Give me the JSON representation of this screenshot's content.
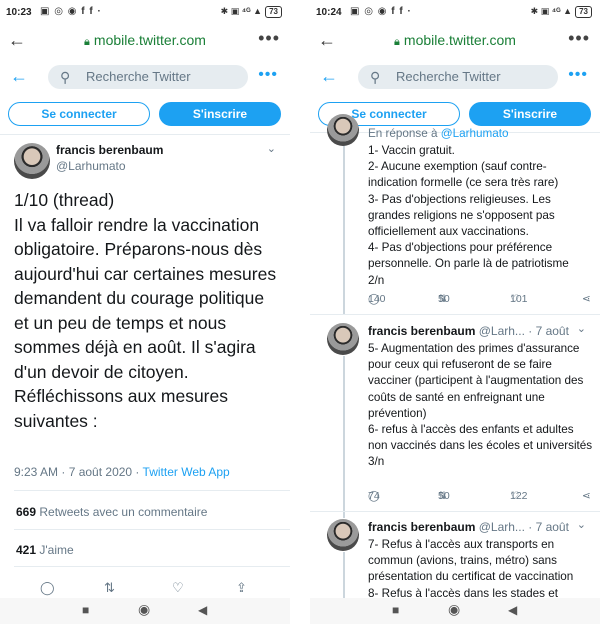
{
  "left": {
    "status": {
      "time": "10:23",
      "icons": "▣ ◎ ◉ f f ·",
      "right_icons": "✱ ▣ ⁴ᴳ ▲",
      "battery": "73"
    },
    "browser": {
      "back_icon": "←",
      "host": "mobile.twitter.com",
      "menu_icon": "•••"
    },
    "twitter": {
      "back_icon": "←",
      "search_placeholder": "Recherche Twitter",
      "more_icon": "•••",
      "login": "Se connecter",
      "signup": "S'inscrire"
    },
    "tweet": {
      "name": "francis berenbaum",
      "handle": "@Larhumato",
      "caret": "⌄",
      "text": "1/10 (thread)\n Il va falloir rendre la vaccination obligatoire. Préparons-nous dès aujourd'hui car certaines mesures demandent du courage politique et un peu de temps et nous sommes déjà en août. Il s'agira d'un devoir de citoyen. Réfléchissons aux mesures suivantes :",
      "date": "9:23 AM · 7 août 2020 · ",
      "source": "Twitter Web App",
      "retweets_count": "669",
      "retweets_label": " Retweets avec un commentaire",
      "likes_count": "421",
      "likes_label": " J'aime"
    },
    "actions": [
      "◯",
      "⇅",
      "♡",
      "⇪"
    ]
  },
  "right": {
    "status": {
      "time": "10:24",
      "icons": "▣ ◎ ◉ f f ·",
      "right_icons": "✱ ▣ ⁴ᴳ ▲",
      "battery": "73"
    },
    "browser": {
      "back_icon": "←",
      "host": "mobile.twitter.com",
      "menu_icon": "•••"
    },
    "twitter": {
      "back_icon": "←",
      "search_placeholder": "Recherche Twitter",
      "more_icon": "•••",
      "login": "Se connecter",
      "signup": "S'inscrire"
    },
    "tweet2": {
      "reply_prefix": "En réponse à ",
      "reply_mention": "@Larhumato",
      "text": "1- Vaccin gratuit.\n2- Aucune exemption (sauf contre-indication formelle (ce sera très rare)\n3- Pas d'objections religieuses. Les grandes religions ne s'opposent pas officiellement aux vaccinations.\n4- Pas d'objections pour préférence personnelle. On parle là de patriotisme\n2/n",
      "replies": "140",
      "retweets": "50",
      "likes": "101"
    },
    "tweet3": {
      "name": "francis berenbaum",
      "handle": " @Larh... · 7 août",
      "text": "5- Augmentation des primes d'assurance pour ceux qui refuseront de se faire vacciner (participent à l'augmentation des coûts de santé en enfreignant une prévention)\n6- refus à l'accès des enfants et adultes non vaccinés dans les écoles et universités\n3/n",
      "replies": "74",
      "retweets": "50",
      "likes": "122"
    },
    "tweet4": {
      "name": "francis berenbaum",
      "handle": " @Larh... · 7 août",
      "text": "7- Refus à l'accès aux transports en commun (avions, trains, métro) sans présentation du certificat de vaccination\n8- Refus à l'accès dans les stades et"
    },
    "action_icons": {
      "reply": "◯",
      "retweet": "⇅",
      "like": "♡",
      "share": "⋖"
    }
  },
  "navbar": [
    "■",
    "◉",
    "◀"
  ]
}
